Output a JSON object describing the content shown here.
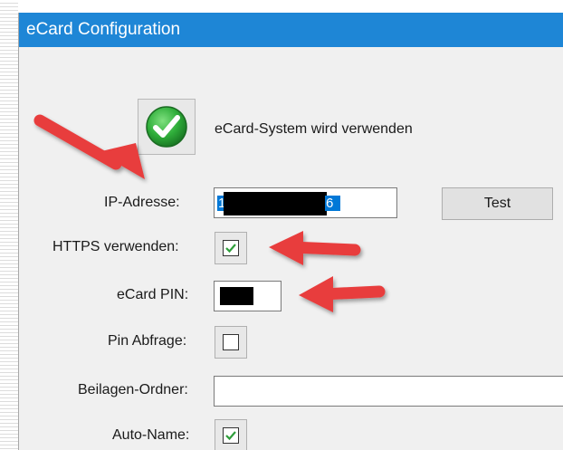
{
  "window": {
    "title": "eCard Configuration"
  },
  "status": {
    "icon": "green-checkmark-icon",
    "text": "eCard-System wird verwenden"
  },
  "form": {
    "ip_label": "IP-Adresse:",
    "ip_value_visible_start": "1",
    "ip_value_visible_end": "6",
    "test_button_label": "Test",
    "https_label": "HTTPS verwenden:",
    "https_checked": true,
    "pin_label": "eCard PIN:",
    "pin_abfrage_label": "Pin Abfrage:",
    "pin_abfrage_checked": false,
    "beilagen_label": "Beilagen-Ordner:",
    "beilagen_value": "",
    "auto_name_label": "Auto-Name:",
    "auto_name_checked": true
  },
  "colors": {
    "titlebar": "#1e86d6",
    "annotation_arrow": "#e83e3e",
    "selection": "#0078d7",
    "check_green": "#2e9e3a"
  }
}
